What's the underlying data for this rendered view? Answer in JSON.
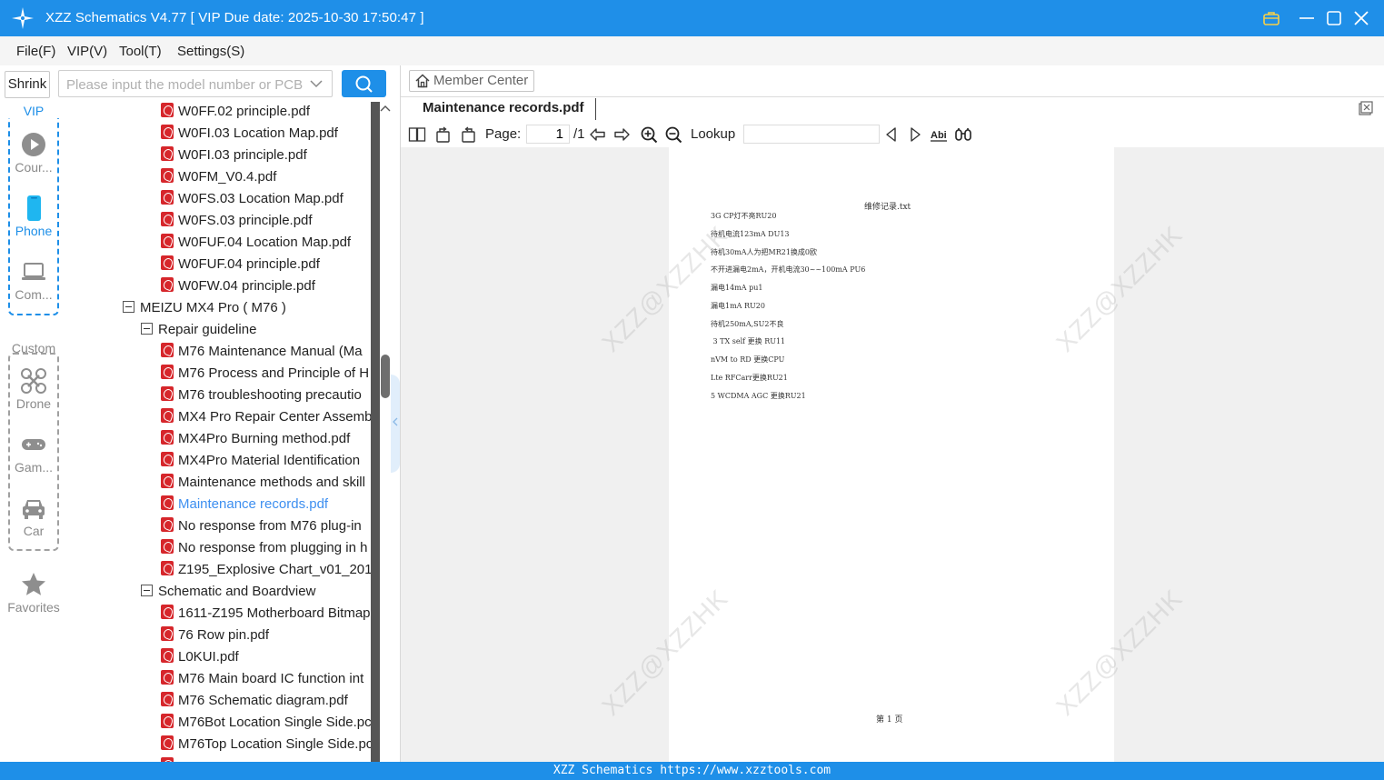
{
  "window": {
    "title": "XZZ Schematics V4.77 [ VIP Due date: 2025-10-30 17:50:47 ]"
  },
  "menu": [
    "File(F)",
    "VIP(V)",
    "Tool(T)",
    "Settings(S)"
  ],
  "sidebar": {
    "shrink_label": "Shrink",
    "vip_label": "VIP",
    "vip_items": [
      {
        "label": "Cour...",
        "icon": "play-icon"
      },
      {
        "label": "Phone",
        "icon": "phone-icon"
      },
      {
        "label": "Com...",
        "icon": "laptop-icon"
      }
    ],
    "custom_label": "Custom",
    "custom_items": [
      {
        "label": "Drone",
        "icon": "drone-icon"
      },
      {
        "label": "Gam...",
        "icon": "gamepad-icon"
      },
      {
        "label": "Car",
        "icon": "car-icon"
      }
    ],
    "favorites_label": "Favorites"
  },
  "search": {
    "placeholder": "Please input the model number or PCB"
  },
  "tree": {
    "top_files": [
      "W0FF.02 principle.pdf",
      "W0FI.03 Location Map.pdf",
      "W0FI.03 principle.pdf",
      "W0FM_V0.4.pdf",
      "W0FS.03 Location Map.pdf",
      "W0FS.03 principle.pdf",
      "W0FUF.04 Location Map.pdf",
      "W0FUF.04 principle.pdf",
      "W0FW.04 principle.pdf"
    ],
    "model": "MEIZU MX4 Pro ( M76 )",
    "folder1": "Repair guideline",
    "folder1_files": [
      "M76 Maintenance Manual (Ma",
      "M76 Process and Principle of H",
      "M76 troubleshooting precautio",
      "MX4 Pro Repair Center Assembl",
      "MX4Pro Burning method.pdf",
      "MX4Pro Material Identification",
      "Maintenance methods and skill",
      "Maintenance records.pdf",
      "No response from M76 plug-in",
      "No response from plugging in h",
      "Z195_Explosive Chart_v01_2016("
    ],
    "active_file": "Maintenance records.pdf",
    "folder2": "Schematic and Boardview",
    "folder2_files": [
      "1611-Z195 Motherboard Bitmap",
      "76 Row pin.pdf",
      "L0KUI.pdf",
      "M76 Main board IC function int",
      "M76 Schematic diagram.pdf",
      "M76Bot Location Single Side.pc",
      "M76Top Location Single Side.pc"
    ]
  },
  "viewer": {
    "member_center": "Member Center",
    "tab_title": "Maintenance records.pdf",
    "page_label": "Page:",
    "page_value": "1",
    "page_total": "/1",
    "lookup_label": "Lookup",
    "doc": {
      "heading": "维修记录.txt",
      "lines": [
        "3G CP灯不亮RU20",
        "待机电流123mA DU13",
        "待机30mA人为把MR21换成0欧",
        "不开进漏电2mA，开机电流30~~100mA PU6",
        "漏电14mA pu1",
        "漏电1mA RU20",
        "待机250mA,SU2不良",
        " 3 TX self 更换 RU11",
        "nVM to RD 更换CPU",
        "Lte RFCarr更换RU21",
        "5 WCDMA AGC 更换RU21"
      ],
      "footer": "第 1 页"
    },
    "watermark": "XZZ@XZZHK"
  },
  "statusbar": "XZZ Schematics https://www.xzztools.com",
  "colors": {
    "brand_blue": "#1f8fe8",
    "active_link": "#3d8ff0",
    "pdf_red": "#d6262b"
  }
}
